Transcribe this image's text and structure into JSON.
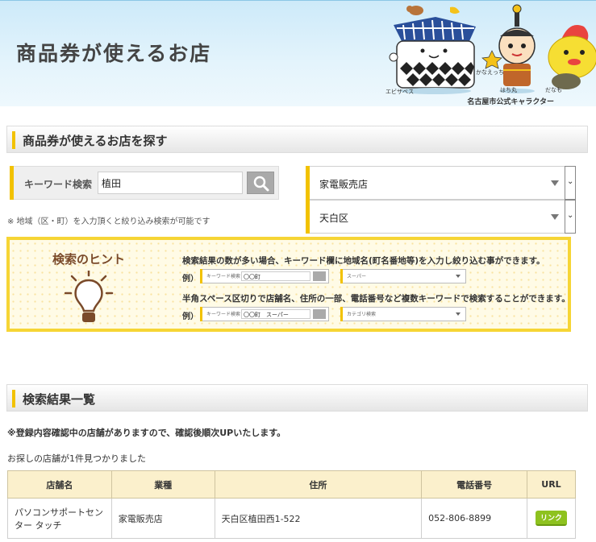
{
  "banner": {
    "title": "商品券が使えるお店",
    "characters": [
      "エビザベス",
      "かなえっち",
      "はち丸",
      "だなも"
    ],
    "official_caption": "名古屋市公式キャラクター"
  },
  "search_section": {
    "heading": "商品券が使えるお店を探す",
    "keyword_label": "キーワード検索",
    "keyword_value": "植田",
    "search_icon": "magnifier-icon",
    "note": "※ 地域（区・町）を入力頂くと絞り込み検索が可能です",
    "category_select": "家電販売店",
    "ward_select": "天白区",
    "accent_color": "#f2c200"
  },
  "hint": {
    "title": "検索のヒント",
    "line1": "検索結果の数が多い場合、キーワード欄に地域名(町名番地等)を入力し絞り込む事ができます。",
    "example1": {
      "prefix": "例）",
      "label": "キーワード検索",
      "value": "〇〇町",
      "select": "スーパー"
    },
    "line2": "半角スペース区切りで店舗名、住所の一部、電話番号など複数キーワードで検索することができます。",
    "example2": {
      "prefix": "例）",
      "label": "キーワード検索",
      "value": "〇〇町　スーパー",
      "select": "カテゴリ検索"
    }
  },
  "results_section": {
    "heading": "検索結果一覧",
    "notice": "※登録内容確認中の店舗がありますので、確認後順次UPいたします。",
    "found_text": "お探しの店舗が1件見つかりました",
    "columns": [
      "店舗名",
      "業種",
      "住所",
      "電話番号",
      "URL"
    ],
    "rows": [
      {
        "name": "パソコンサポートセンター タッチ",
        "category": "家電販売店",
        "address": "天白区植田西1-522",
        "phone": "052-806-8899",
        "url_label": "リンク"
      }
    ]
  }
}
